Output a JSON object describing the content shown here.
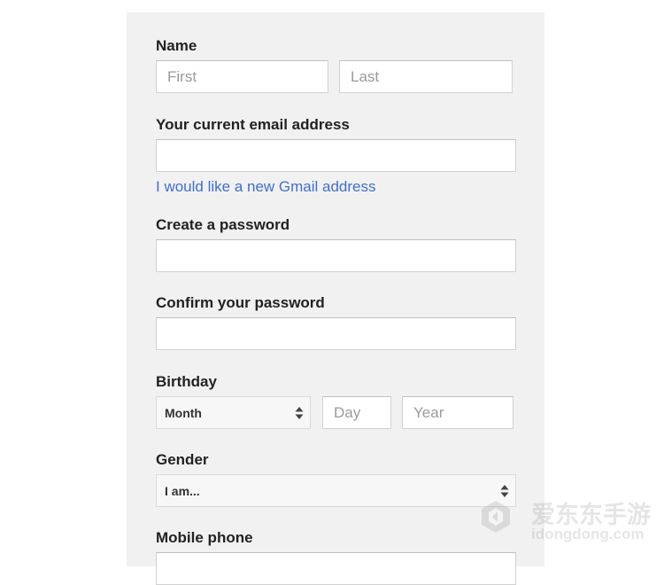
{
  "form": {
    "name": {
      "label": "Name",
      "first_placeholder": "First",
      "last_placeholder": "Last"
    },
    "email": {
      "label": "Your current email address",
      "value": "",
      "gmail_link": "I would like a new Gmail address"
    },
    "password": {
      "label": "Create a password",
      "value": ""
    },
    "confirm_password": {
      "label": "Confirm your password",
      "value": ""
    },
    "birthday": {
      "label": "Birthday",
      "month_selected": "Month",
      "day_placeholder": "Day",
      "year_placeholder": "Year"
    },
    "gender": {
      "label": "Gender",
      "selected": "I am..."
    },
    "mobile_phone": {
      "label": "Mobile phone"
    }
  },
  "watermark": {
    "text_cn": "爱东东手游",
    "text_en": "idongdong.com"
  }
}
